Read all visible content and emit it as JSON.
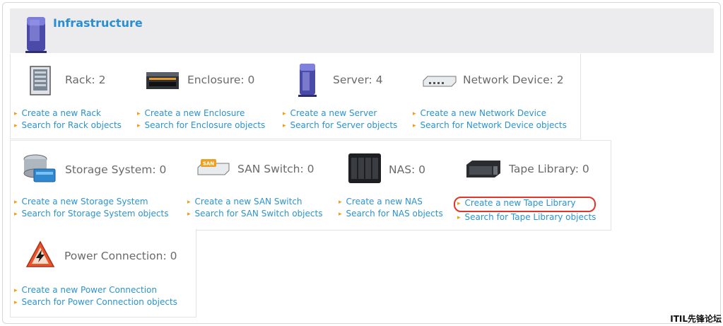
{
  "header": {
    "title": "Infrastructure"
  },
  "items": [
    {
      "icon": "rack-icon",
      "label": "Rack: 2",
      "create": "Create a new Rack",
      "search": "Search for Rack objects"
    },
    {
      "icon": "enclosure-icon",
      "label": "Enclosure: 0",
      "create": "Create a new Enclosure",
      "search": "Search for Enclosure objects"
    },
    {
      "icon": "server-icon",
      "label": "Server: 4",
      "create": "Create a new Server",
      "search": "Search for Server objects"
    },
    {
      "icon": "network-device-icon",
      "label": "Network Device: 2",
      "create": "Create a new Network Device",
      "search": "Search for Network Device objects"
    },
    {
      "icon": "storage-system-icon",
      "label": "Storage System: 0",
      "create": "Create a new Storage System",
      "search": "Search for Storage System objects"
    },
    {
      "icon": "san-switch-icon",
      "label": "SAN Switch: 0",
      "create": "Create a new SAN Switch",
      "search": "Search for SAN Switch objects"
    },
    {
      "icon": "nas-icon",
      "label": "NAS: 0",
      "create": "Create a new NAS",
      "search": "Search for NAS objects"
    },
    {
      "icon": "tape-library-icon",
      "label": "Tape Library: 0",
      "create": "Create a new Tape Library",
      "search": "Search for Tape Library objects"
    },
    {
      "icon": "power-connection-icon",
      "label": "Power Connection: 0",
      "create": "Create a new Power Connection",
      "search": "Search for Power Connection objects"
    }
  ],
  "san_badge": "SAN",
  "watermark": "ITIL先锋论坛",
  "colors": {
    "link": "#2b93d0",
    "bullet": "#f39c12",
    "title": "#2a8fd2",
    "highlight": "#e0362a"
  }
}
